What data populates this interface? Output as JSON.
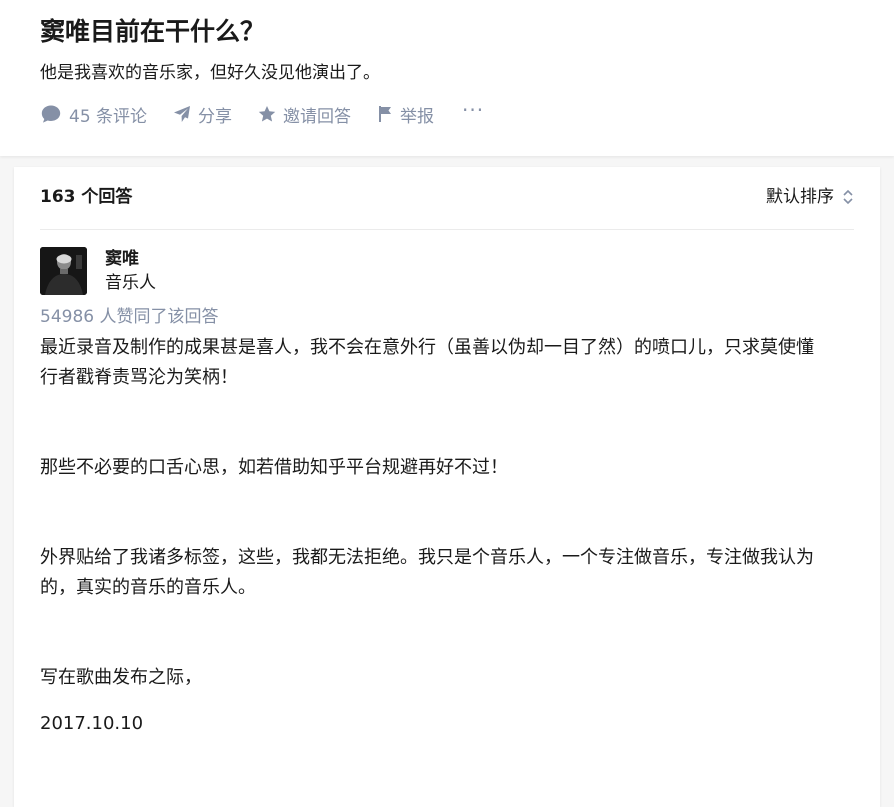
{
  "question": {
    "title": "窦唯目前在干什么？",
    "detail": "他是我喜欢的音乐家，但好久没见他演出了。",
    "actions": {
      "comments_label": "45 条评论",
      "share_label": "分享",
      "invite_label": "邀请回答",
      "report_label": "举报",
      "more_label": "···"
    }
  },
  "answers": {
    "count_label": "163 个回答",
    "sort_label": "默认排序"
  },
  "answer": {
    "author_name": "窦唯",
    "author_headline": "音乐人",
    "vote_text": "54986 人赞同了该回答",
    "paragraphs": [
      "最近录音及制作的成果甚是喜人，我不会在意外行（虽善以伪却一目了然）的喷口儿，只求莫使懂",
      "行者戳脊责骂沦为笑柄！",
      "那些不必要的口舌心思，如若借助知乎平台规避再好不过！",
      "外界贴给了我诸多标签，这些，我都无法拒绝。我只是个音乐人，一个专注做音乐，专注做我认为",
      "的，真实的音乐的音乐人。",
      "写在歌曲发布之际，",
      "2017.10.10"
    ]
  },
  "colors": {
    "meta_gray": "#8590a6",
    "text_primary": "#1a1a1a",
    "page_bg": "#f6f6f6"
  },
  "icons": [
    "comment-icon",
    "share-icon",
    "star-icon",
    "flag-icon",
    "sort-icon"
  ]
}
